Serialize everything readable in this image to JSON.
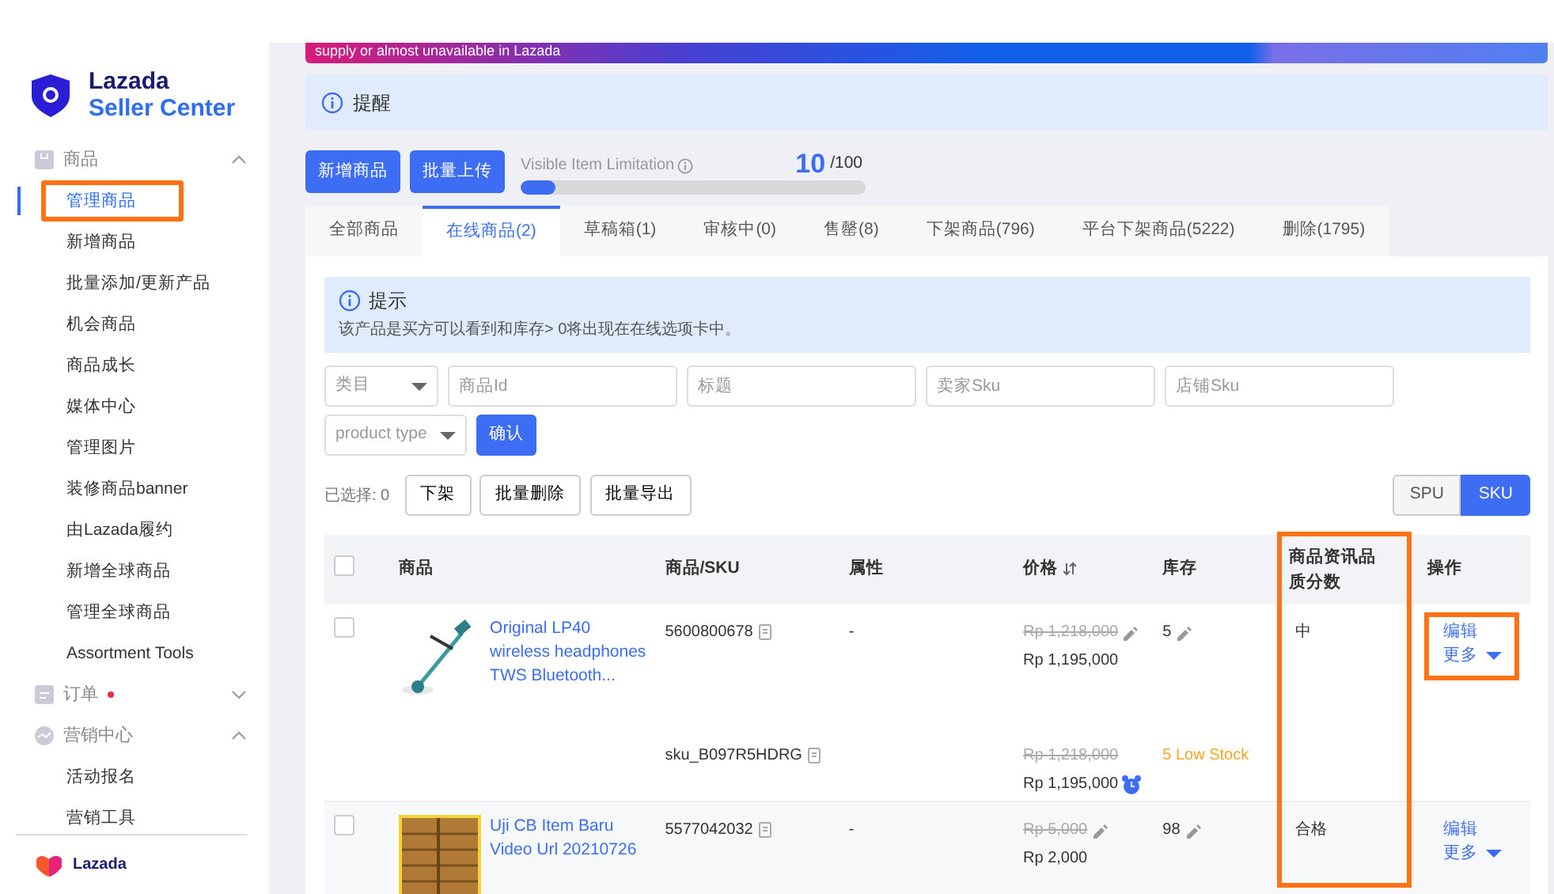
{
  "sidebar": {
    "brand": {
      "name": "Lazada",
      "subtitle": "Seller Center"
    },
    "groups": [
      {
        "label": "商品",
        "expanded": true,
        "dot": false,
        "items": [
          {
            "label": "管理商品",
            "selected": true,
            "highlighted": true
          },
          {
            "label": "新增商品",
            "selected": false,
            "highlighted": false
          },
          {
            "label": "批量添加/更新产品",
            "selected": false,
            "highlighted": false
          },
          {
            "label": "机会商品",
            "selected": false,
            "highlighted": false
          },
          {
            "label": "商品成长",
            "selected": false,
            "highlighted": false
          },
          {
            "label": "媒体中心",
            "selected": false,
            "highlighted": false
          },
          {
            "label": "管理图片",
            "selected": false,
            "highlighted": false
          },
          {
            "label": "装修商品banner",
            "selected": false,
            "highlighted": false
          },
          {
            "label": "由Lazada履约",
            "selected": false,
            "highlighted": false
          },
          {
            "label": "新增全球商品",
            "selected": false,
            "highlighted": false
          },
          {
            "label": "管理全球商品",
            "selected": false,
            "highlighted": false
          },
          {
            "label": "Assortment Tools",
            "selected": false,
            "highlighted": false
          }
        ]
      },
      {
        "label": "订单",
        "expanded": false,
        "dot": true
      },
      {
        "label": "营销中心",
        "expanded": true,
        "dot": false,
        "items": [
          {
            "label": "活动报名",
            "selected": false,
            "highlighted": false
          },
          {
            "label": "营销工具",
            "selected": false,
            "highlighted": false
          }
        ]
      }
    ],
    "footer": "Lazada"
  },
  "banner": {
    "text": "supply or almost unavailable in Lazada"
  },
  "reminder": {
    "title": "提醒"
  },
  "toolbar": {
    "buttons": [
      "新增商品",
      "批量上传"
    ],
    "limit": {
      "label": "Visible Item Limitation",
      "count": "10",
      "total": "/100",
      "level": 0.1
    }
  },
  "tabs": [
    {
      "label": "全部商品",
      "selected": false
    },
    {
      "label": "在线商品(2)",
      "selected": true
    },
    {
      "label": "草稿箱(1)",
      "selected": false
    },
    {
      "label": "审核中(0)",
      "selected": false
    },
    {
      "label": "售罄(8)",
      "selected": false
    },
    {
      "label": "下架商品(796)",
      "selected": false
    },
    {
      "label": "平台下架商品(5222)",
      "selected": false
    },
    {
      "label": "删除(1795)",
      "selected": false
    }
  ],
  "notice": {
    "title": "提示",
    "text": "该产品是买方可以看到和库存> 0将出现在在线选项卡中。"
  },
  "filters": [
    {
      "kind": "select",
      "placeholder": "类目"
    },
    {
      "kind": "input",
      "placeholder": "商品Id"
    },
    {
      "kind": "input",
      "placeholder": "标题"
    },
    {
      "kind": "input",
      "placeholder": "卖家Sku"
    },
    {
      "kind": "input",
      "placeholder": "店铺Sku"
    },
    {
      "kind": "select",
      "placeholder": "product type"
    }
  ],
  "confirm": "确认",
  "bulk": {
    "selected_label": "已选择: 0",
    "buttons": [
      "下架",
      "批量删除",
      "批量导出"
    ],
    "views": [
      {
        "label": "SPU",
        "selected": false
      },
      {
        "label": "SKU",
        "selected": true
      }
    ]
  },
  "table": {
    "select_all": false,
    "columns": [
      {
        "label": "商品",
        "sortable": false,
        "highlighted": false
      },
      {
        "label": "商品/SKU",
        "sortable": false,
        "highlighted": false
      },
      {
        "label": "属性",
        "sortable": false,
        "highlighted": false
      },
      {
        "label": "价格",
        "sortable": true,
        "highlighted": false
      },
      {
        "label": "库存",
        "sortable": false,
        "highlighted": false
      },
      {
        "label": "商品资讯品质分数",
        "sortable": false,
        "highlighted": true
      },
      {
        "label": "操作",
        "sortable": false,
        "highlighted": false
      }
    ],
    "rows": [
      {
        "checked": false,
        "image": {
          "kind": "picture"
        },
        "title": "Original LP40 wireless headphones TWS Bluetooth...",
        "edit": "编辑",
        "more": "更多",
        "actions_highlighted": true,
        "skus": [
          {
            "id": "5600800678",
            "attribute": "-",
            "old_price": "Rp 1,218,000",
            "price": "Rp 1,195,000",
            "price_alarm": false,
            "stock": "5",
            "quality": "中"
          },
          {
            "id": "sku_B097R5HDRG",
            "old_price": "Rp 1,218,000",
            "price": "Rp 1,195,000",
            "price_alarm": true,
            "stock": "5",
            "stock_warning": "Low Stock"
          }
        ]
      },
      {
        "checked": false,
        "image": {
          "kind": "picture"
        },
        "title": "Uji CB Item Baru Video Url 20210726",
        "edit": "编辑",
        "more": "更多",
        "actions_highlighted": false,
        "skus": [
          {
            "id": "5577042032",
            "attribute": "-",
            "old_price": "Rp 5,000",
            "price": "Rp 2,000",
            "price_alarm": false,
            "stock": "98",
            "quality": "合格"
          }
        ]
      }
    ]
  }
}
